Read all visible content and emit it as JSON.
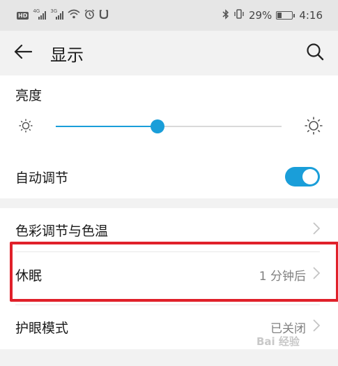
{
  "status_bar": {
    "hd_badge": "HD",
    "net1": "4G",
    "net2": "3G",
    "battery_percent": "29%",
    "battery_level": 0.29,
    "time": "4:16"
  },
  "header": {
    "title": "显示"
  },
  "brightness": {
    "label": "亮度",
    "level": 0.45,
    "accent": "#1a9ed9"
  },
  "auto_adjust": {
    "label": "自动调节",
    "enabled": true
  },
  "menu": {
    "color_temp": {
      "label": "色彩调节与色温"
    },
    "sleep": {
      "label": "休眠",
      "value": "1 分钟后"
    },
    "eye_comfort": {
      "label": "护眼模式",
      "value": "已关闭"
    }
  },
  "icons": {
    "back": "arrow-left-icon",
    "search": "search-icon",
    "chevron": "chevron-right-icon",
    "brightness_low": "sun-small-icon",
    "brightness_high": "sun-large-icon"
  },
  "highlight_color": "#e0202a",
  "watermark": "Bai 经验"
}
